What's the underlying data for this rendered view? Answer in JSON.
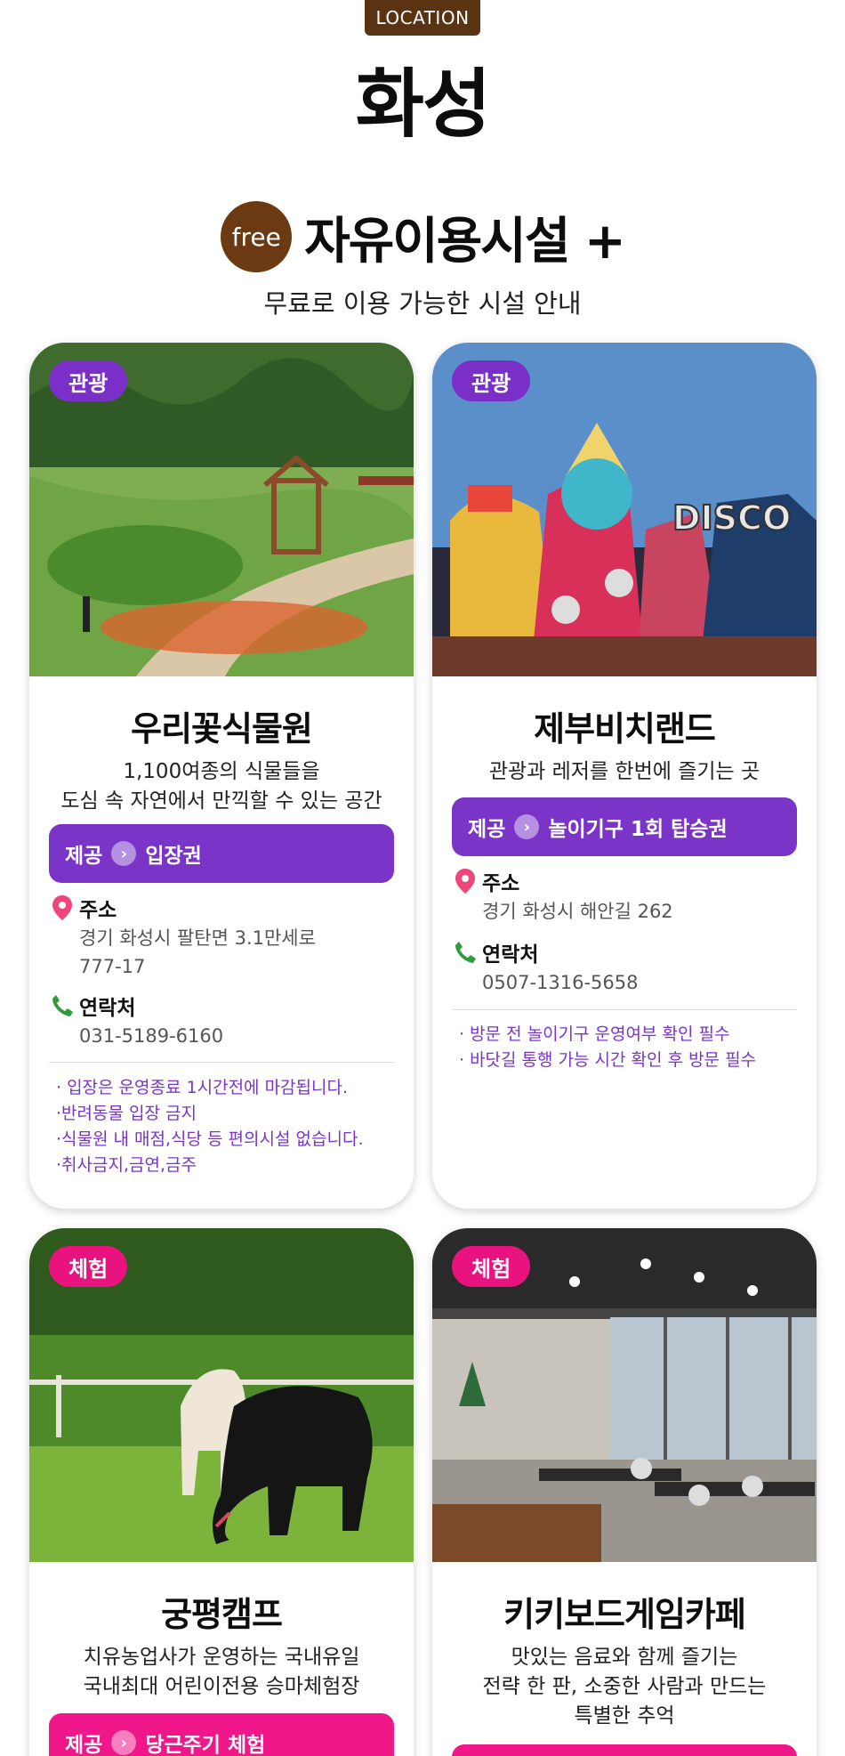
{
  "header": {
    "location_label": "LOCATION",
    "title": "화성"
  },
  "section": {
    "free_label": "free",
    "title": "자유이용시설 +",
    "subtitle": "무료로 이용 가능한 시설 안내"
  },
  "labels": {
    "address": "주소",
    "contact": "연락처",
    "offer_prefix": "제공"
  },
  "cards": [
    {
      "category": "관광",
      "name": "우리꽃식물원",
      "desc_lines": [
        "1,100여종의 식물들을",
        "도심 속 자연에서 만끽할 수 있는 공간"
      ],
      "offer": "입장권",
      "address_lines": [
        "경기 화성시 팔탄면 3.1만세로",
        "777-17"
      ],
      "phone": "031-5189-6160",
      "notes": [
        "· 입장은 운영종료 1시간전에 마감됩니다.",
        "·반려동물 입장 금지",
        "·식물원 내 매점,식당 등 편의시설 없습니다.",
        "·취사금지,금연,금주"
      ]
    },
    {
      "category": "관광",
      "name": "제부비치랜드",
      "desc_lines": [
        "관광과 레저를 한번에 즐기는 곳"
      ],
      "offer": "놀이기구 1회 탑승권",
      "address_lines": [
        "경기 화성시 해안길 262"
      ],
      "phone": "0507-1316-5658",
      "notes": [
        "· 방문 전 놀이기구 운영여부 확인 필수",
        "· 바닷길 통행 가능 시간 확인 후 방문 필수"
      ]
    },
    {
      "category": "체험",
      "name": "궁평캠프",
      "desc_lines": [
        "치유농업사가 운영하는 국내유일",
        "국내최대 어린이전용 승마체험장"
      ],
      "offer": "당근주기 체험"
    },
    {
      "category": "체험",
      "name": "키키보드게임카페",
      "desc_lines": [
        "맛있는 음료와 함께 즐기는",
        "전략 한 판, 소중한 사람과 만드는",
        "특별한 추억"
      ],
      "offer": ""
    }
  ],
  "colors": {
    "brown": "#5a3312",
    "purple": "#7a35c8",
    "pink": "#f0178a"
  }
}
